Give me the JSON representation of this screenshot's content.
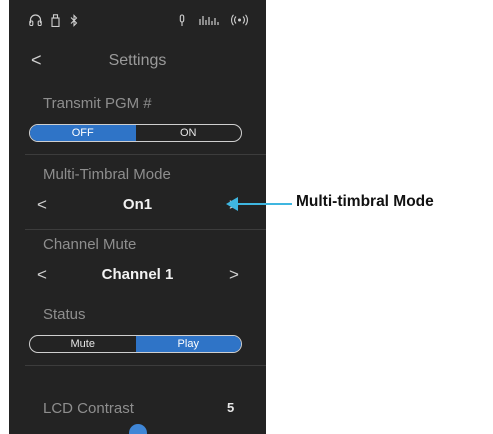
{
  "statusbar": {
    "icons": [
      "headphones-icon",
      "usb-memory-icon",
      "bluetooth-icon",
      "mic-icon",
      "audio-level-icon",
      "wireless-icon"
    ]
  },
  "navbar": {
    "back": "<",
    "title": "Settings"
  },
  "transmit_pgm": {
    "label": "Transmit PGM #",
    "off": "OFF",
    "on": "ON",
    "selected": "OFF"
  },
  "multi_timbral": {
    "label": "Multi-Timbral Mode",
    "value": "On1",
    "prev": "<",
    "next": ">"
  },
  "channel_mute": {
    "label": "Channel Mute",
    "value": "Channel 1",
    "prev": "<",
    "next": ">"
  },
  "status": {
    "label": "Status",
    "mute": "Mute",
    "play": "Play",
    "selected": "Play"
  },
  "lcd_contrast": {
    "label": "LCD Contrast",
    "value": "5"
  },
  "callout": {
    "text": "Multi-timbral Mode",
    "color": "#3fb6e0"
  },
  "colors": {
    "accent": "#2f74c7",
    "background": "#232323"
  }
}
